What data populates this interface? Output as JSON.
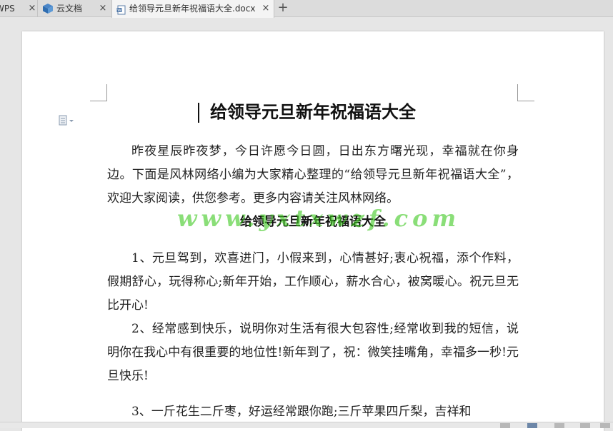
{
  "tabs": [
    {
      "label": "WPS",
      "close": "×"
    },
    {
      "label": "云文档",
      "close": "×",
      "icon": "cube-icon"
    },
    {
      "label": "给领导元旦新年祝福语大全.docx",
      "close": "×",
      "icon": "word-doc-icon",
      "active": true
    }
  ],
  "new_tab": "+",
  "document": {
    "title": "给领导元旦新年祝福语大全",
    "intro": "昨夜星辰昨夜梦，今日许愿今日圆，日出东方曙光现，幸福就在你身边。下面是风林网络小编为大家精心整理的“给领导元旦新年祝福语大全”，欢迎大家阅读，供您参考。更多内容请关注风林网络。",
    "subtitle": "给领导元旦新年祝福语大全",
    "watermark": "www.yxtxwzf.com",
    "items": [
      "1、元旦驾到，欢喜进门，小假来到，心情甚好;衷心祝福，添个作料，假期舒心，玩得称心;新年开始，工作顺心，薪水合心，被窝暖心。祝元旦无比开心!",
      "2、经常感到快乐，说明你对生活有很大包容性;经常收到我的短信，说明你在我心中有很重要的地位性!新年到了，祝：微笑挂嘴角，幸福多一秒!元旦快乐!",
      "3、一斤花生二斤枣，好运经常跟你跑;三斤苹果四斤梨，吉祥和"
    ]
  },
  "colors": {
    "accent": "#6d87a8",
    "watermark": "#3cc81e"
  }
}
